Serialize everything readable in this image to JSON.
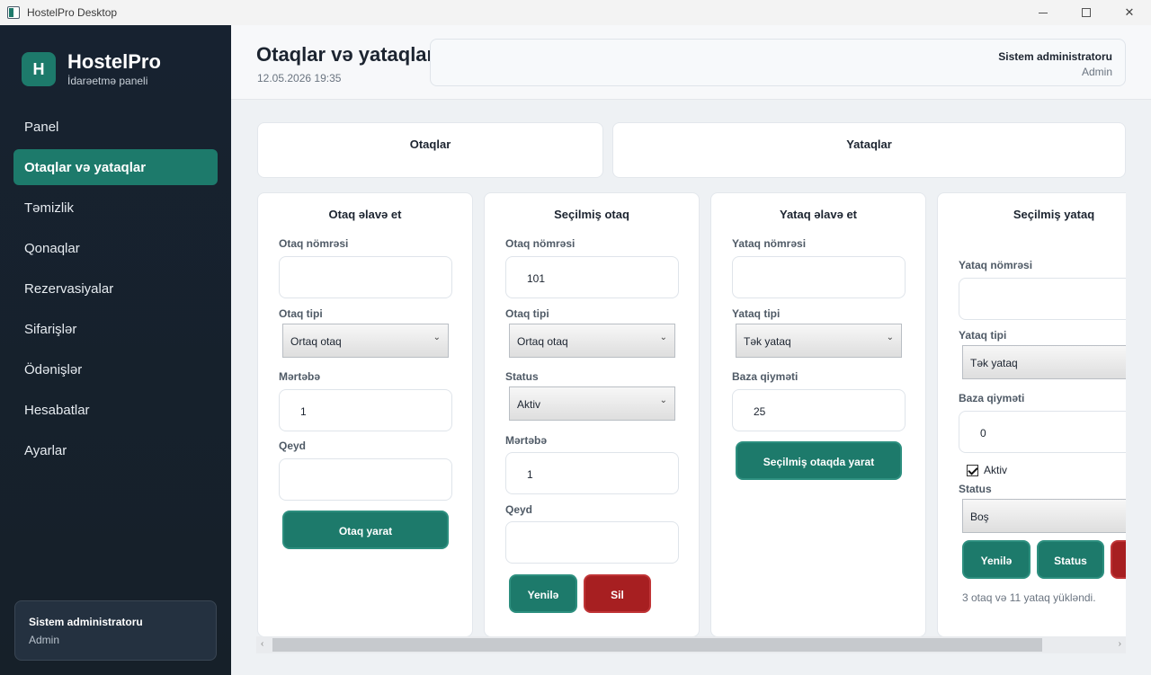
{
  "window": {
    "title": "HostelPro Desktop"
  },
  "brand": {
    "logo_letter": "H",
    "name": "HostelPro",
    "subtitle": "İdarəetmə paneli"
  },
  "nav": {
    "items": [
      {
        "label": "Panel"
      },
      {
        "label": "Otaqlar və yataqlar"
      },
      {
        "label": "Təmizlik"
      },
      {
        "label": "Qonaqlar"
      },
      {
        "label": "Rezervasiyalar"
      },
      {
        "label": "Sifarişlər"
      },
      {
        "label": "Ödənişlər"
      },
      {
        "label": "Hesabatlar"
      },
      {
        "label": "Ayarlar"
      }
    ],
    "active": "Otaqlar və yataqlar"
  },
  "sidebar_user": {
    "name": "Sistem administratoru",
    "role": "Admin"
  },
  "header": {
    "title": "Otaqlar və yataqlar",
    "datetime": "12.05.2026 19:35",
    "user_name": "Sistem administratoru",
    "user_role": "Admin"
  },
  "tabs": {
    "rooms": "Otaqlar",
    "beds": "Yataqlar"
  },
  "add_room": {
    "title": "Otaq əlavə et",
    "room_number_label": "Otaq nömrəsi",
    "room_number_value": "",
    "room_type_label": "Otaq tipi",
    "room_type_value": "Ortaq otaq",
    "floor_label": "Mərtəbə",
    "floor_value": "1",
    "note_label": "Qeyd",
    "note_value": "",
    "create_button": "Otaq yarat"
  },
  "selected_room": {
    "title": "Seçilmiş otaq",
    "room_number_label": "Otaq nömrəsi",
    "room_number_value": "101",
    "room_type_label": "Otaq tipi",
    "room_type_value": "Ortaq otaq",
    "status_label": "Status",
    "status_value": "Aktiv",
    "floor_label": "Mərtəbə",
    "floor_value": "1",
    "note_label": "Qeyd",
    "note_value": "",
    "update_button": "Yenilə",
    "delete_button": "Sil"
  },
  "add_bed": {
    "title": "Yataq əlavə et",
    "bed_number_label": "Yataq nömrəsi",
    "bed_number_value": "",
    "bed_type_label": "Yataq tipi",
    "bed_type_value": "Tək yataq",
    "base_price_label": "Baza qiyməti",
    "base_price_value": "25",
    "create_button": "Seçilmiş otaqda yarat"
  },
  "selected_bed": {
    "title": "Seçilmiş yataq",
    "bed_number_label": "Yataq nömrəsi",
    "bed_number_value": "",
    "bed_type_label": "Yataq tipi",
    "bed_type_value": "Tək yataq",
    "base_price_label": "Baza qiyməti",
    "base_price_value": "0",
    "active_label": "Aktiv",
    "active_checked": true,
    "status_label": "Status",
    "status_value": "Boş",
    "update_button": "Yenilə",
    "status_button": "Status",
    "load_info": "3 otaq və 11 yataq yükləndi."
  },
  "colors": {
    "accent": "#1d7a6b",
    "danger": "#a71f21",
    "sidebar": "#172230"
  }
}
